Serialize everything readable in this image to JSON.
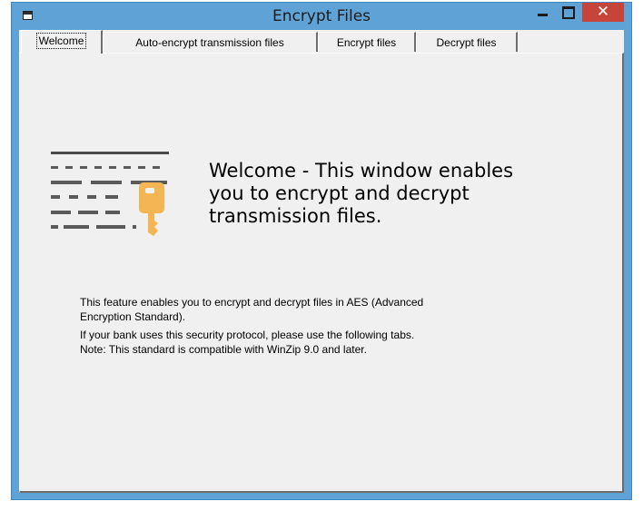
{
  "window": {
    "title": "Encrypt Files",
    "close_glyph": "✕",
    "accent": "#5fa3d6",
    "close_color": "#c7443a"
  },
  "tabs": [
    {
      "label": "Welcome",
      "active": true
    },
    {
      "label": "Auto-encrypt transmission files",
      "active": false
    },
    {
      "label": "Encrypt files",
      "active": false
    },
    {
      "label": "Decrypt files",
      "active": false
    }
  ],
  "welcome": {
    "illustration_icon": "encrypted-file-key-icon",
    "headline_lines": [
      "Welcome - This window enables",
      "you to encrypt and decrypt",
      "transmission files."
    ],
    "paragraph1_lines": [
      "This feature enables you to encrypt and decrypt files in AES (Advanced",
      "Encryption Standard)."
    ],
    "paragraph2_lines": [
      "If your bank uses this security protocol, please use the following tabs.",
      "Note: This standard is compatible with WinZip 9.0 and later."
    ]
  }
}
